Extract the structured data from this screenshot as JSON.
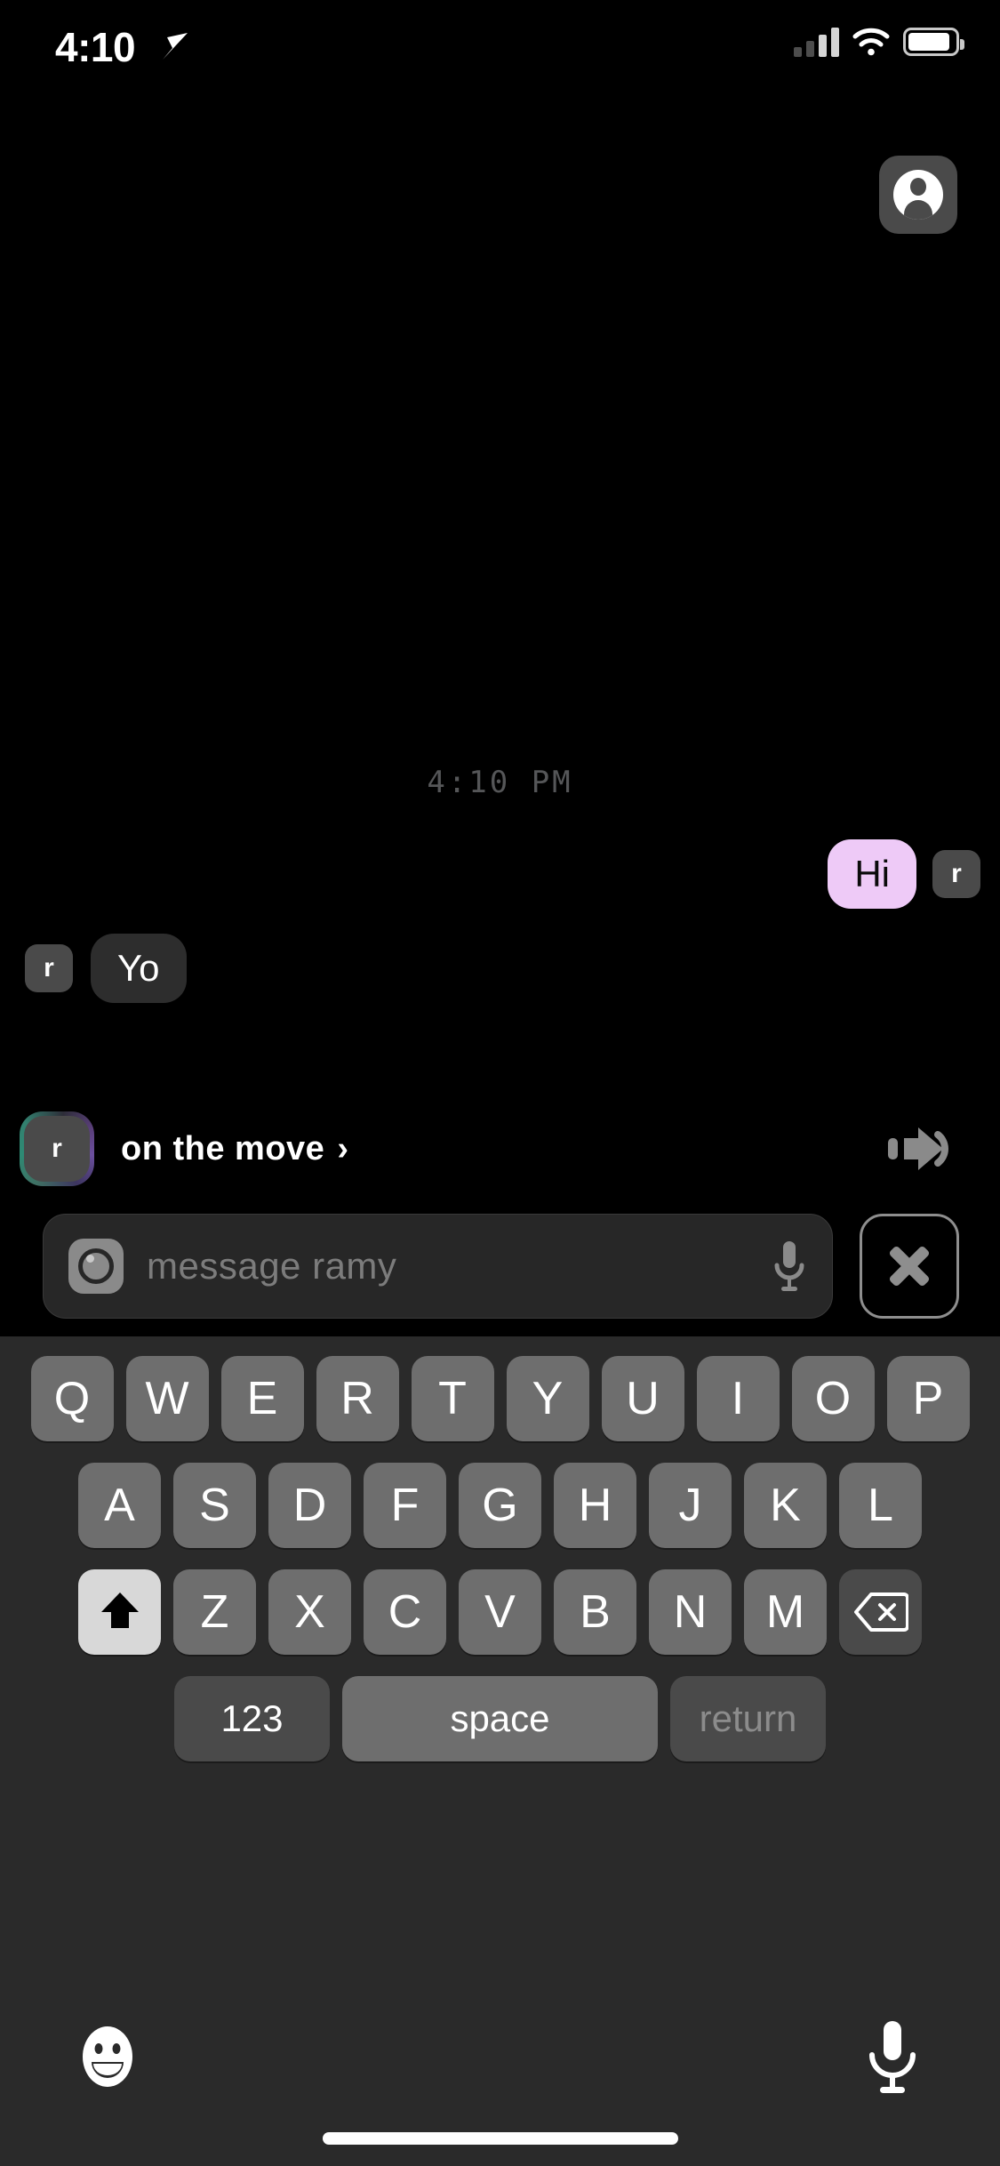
{
  "status_bar": {
    "time": "4:10",
    "location_icon": "location-arrow-icon",
    "signal_icon": "cellular-signal-icon",
    "wifi_icon": "wifi-icon",
    "battery_icon": "battery-full-icon"
  },
  "header": {
    "profile_button_icon": "person-circle-icon"
  },
  "conversation": {
    "daystamp": "4:10 PM",
    "messages": [
      {
        "text": "Hi",
        "sender": "me",
        "avatar_initial": "r",
        "bubble_color": "#EECAF7",
        "text_color": "#0B0B0B"
      },
      {
        "text": "Yo",
        "sender": "them",
        "avatar_initial": "r",
        "bubble_color": "#2D2D2D",
        "text_color": "#FFFFFF"
      }
    ]
  },
  "presence": {
    "avatar_initial": "r",
    "label": "on the move",
    "chevron": "›",
    "ring_colors": [
      "#2E8A74",
      "#6B4F9E",
      "#3D3560"
    ],
    "action_icon": "moving-arrow-icon"
  },
  "composer": {
    "camera_icon": "camera-icon",
    "placeholder": "message ramy",
    "mic_icon": "microphone-icon",
    "close_icon": "close-x-icon"
  },
  "keyboard": {
    "row1": [
      "Q",
      "W",
      "E",
      "R",
      "T",
      "Y",
      "U",
      "I",
      "O",
      "P"
    ],
    "row2": [
      "A",
      "S",
      "D",
      "F",
      "G",
      "H",
      "J",
      "K",
      "L"
    ],
    "row3": [
      "Z",
      "X",
      "C",
      "V",
      "B",
      "N",
      "M"
    ],
    "shift_icon": "shift-up-arrow-icon",
    "backspace_icon": "backspace-delete-icon",
    "numbers_label": "123",
    "space_label": "space",
    "return_label": "return",
    "key_color": "#6E6E6E",
    "shift_active_color": "#D8D8D8",
    "modifier_color": "#4A4A4A"
  },
  "bottom_bar": {
    "emoji_icon": "smiley-face-icon",
    "mic_icon": "microphone-icon",
    "home_indicator": "home-indicator-bar"
  }
}
